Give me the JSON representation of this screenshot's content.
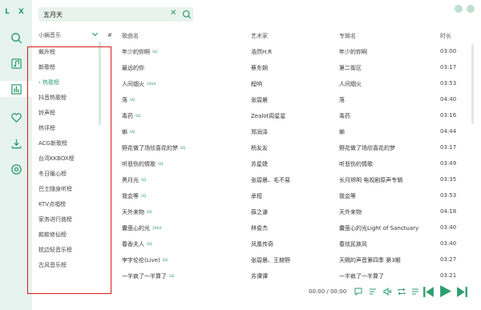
{
  "app": {
    "logo": "L X"
  },
  "colors": {
    "accent": "#2d9d6e",
    "rail_bg": "#e7f3ee",
    "annotation": "#d71a1a"
  },
  "rail": {
    "items": [
      {
        "icon": "search-icon"
      },
      {
        "icon": "music-note-icon"
      },
      {
        "icon": "bar-chart-icon",
        "active": true
      },
      {
        "icon": "heart-icon"
      },
      {
        "icon": "download-icon"
      },
      {
        "icon": "settings-icon"
      }
    ]
  },
  "search": {
    "value": "五月天",
    "clear_icon": "clear-icon",
    "go_icon": "search-icon"
  },
  "window": {
    "minimize_icon": "minimize-icon",
    "close_icon": "close-icon"
  },
  "source": {
    "label": "小蜗音乐",
    "icon": "chevron-down-icon"
  },
  "boards": [
    "飙升榜",
    "新歌榜",
    "热歌榜",
    "抖音热歌榜",
    "铃声榜",
    "热评榜",
    "ACG新歌榜",
    "台湾KKBOX榜",
    "冬日暖心榜",
    "巴士随身听榜",
    "KTV点唱榜",
    "家务进行曲榜",
    "款款修仙榜",
    "枕边轻音乐榜",
    "古风音乐榜"
  ],
  "selected_board_marker": "›",
  "table": {
    "headers": {
      "num": "#",
      "name": "歌曲名",
      "artist": "艺术家",
      "album": "专辑名",
      "time": "时长"
    },
    "rows": [
      {
        "name": "年少的你啊",
        "q": "SQ",
        "artist": "浩然H.R",
        "album": "年少的你啊",
        "time": "03:00"
      },
      {
        "name": "最远的你",
        "q": "",
        "artist": "蔡东娴",
        "album": "第二街区",
        "time": "03:17"
      },
      {
        "name": "人间烟火",
        "q": "24bit",
        "artist": "程响",
        "album": "人间烟火",
        "time": "03:53"
      },
      {
        "name": "落",
        "q": "SQ",
        "artist": "张碧晨",
        "album": "落",
        "time": "04:40"
      },
      {
        "name": "毒药",
        "q": "SQ",
        "artist": "Zealot周星星",
        "album": "毒药",
        "time": "03:16"
      },
      {
        "name": "蝌",
        "q": "SQ",
        "artist": "郑润泽",
        "album": "蝌",
        "time": "04:44"
      },
      {
        "name": "野花做了场欣喜花的梦",
        "q": "SQ",
        "artist": "杨友友",
        "album": "野花做了场欣喜花的梦",
        "time": "03:17"
      },
      {
        "name": "听悲伤的情歌",
        "q": "SQ",
        "artist": "苏星婕",
        "album": "听悲伤的情歌",
        "time": "03:49"
      },
      {
        "name": "黑月光",
        "q": "SQ",
        "artist": "张碧晨、毛不易",
        "album": "长月烬明 电视剧原声专辑",
        "time": "03:35"
      },
      {
        "name": "我会等",
        "q": "SQ",
        "artist": "承桓",
        "album": "我会等",
        "time": "03:53"
      },
      {
        "name": "天外来物",
        "q": "SQ",
        "artist": "薛之谦",
        "album": "天外来物",
        "time": "04:18"
      },
      {
        "name": "囊萤心的光",
        "q": "24bit",
        "artist": "林俊杰",
        "album": "囊萤心的光Light of Sanctuary",
        "time": "03:40"
      },
      {
        "name": "春香夫人",
        "q": "SQ",
        "artist": "凤凰传奇",
        "album": "春炫民族风",
        "time": "03:40"
      },
      {
        "name": "孛字伦伦(Live)",
        "q": "SQ",
        "artist": "张碧晨、王赫野",
        "album": "天赐的声音第四季 第3期",
        "time": "03:27"
      },
      {
        "name": "一半疯了一半算了",
        "q": "SQ",
        "artist": "苏谭谭",
        "album": "一半疯了一半算了",
        "time": "03:21"
      }
    ]
  },
  "player": {
    "time": "00:00 / 00:00",
    "icons": [
      "comment-icon",
      "lyric-icon",
      "mute-icon",
      "repeat-icon",
      "playlist-icon",
      "previous-icon",
      "play-icon",
      "next-icon"
    ]
  }
}
